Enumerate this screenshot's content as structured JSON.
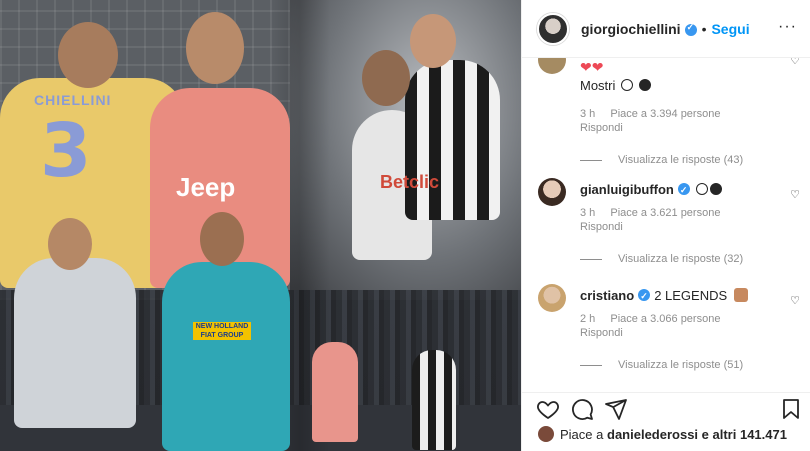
{
  "photo": {
    "jersey_name": "CHIELLINI",
    "jersey_number": "3",
    "shirt_sponsor_1": "Jeep",
    "shirt_sponsor_2": "Betclic",
    "shirt_sponsor_3": "NEW HOLLAND FIAT GROUP"
  },
  "header": {
    "username": "giorgiochiellini",
    "separator": "•",
    "follow_label": "Segui",
    "more_label": "···"
  },
  "comments": [
    {
      "username": "",
      "text_pre": "❤❤",
      "text": "Mostri",
      "time": "",
      "likes": "",
      "reply_label": "",
      "view_replies": "",
      "has_circle_emojis": true
    },
    {
      "username": "",
      "text": "",
      "time": "3 h",
      "likes": "Piace a 3.394 persone",
      "reply_label": "Rispondi",
      "view_replies": "Visualizza le risposte (43)"
    },
    {
      "username": "gianluigibuffon",
      "text": "",
      "time": "3 h",
      "likes": "Piace a 3.621 persone",
      "reply_label": "Rispondi",
      "view_replies": "Visualizza le risposte (32)"
    },
    {
      "username": "cristiano",
      "text": "2 LEGENDS",
      "time": "2 h",
      "likes": "Piace a 3.066 persone",
      "reply_label": "Rispondi",
      "view_replies": "Visualizza le risposte (51)"
    }
  ],
  "footer": {
    "liked_by_prefix": "Piace a",
    "liked_by_user": "danielederossi",
    "liked_by_suffix": "e altri 141.471"
  },
  "colors": {
    "accent": "#0095f6",
    "verified": "#3897f0",
    "muted": "#8e8e8e"
  }
}
